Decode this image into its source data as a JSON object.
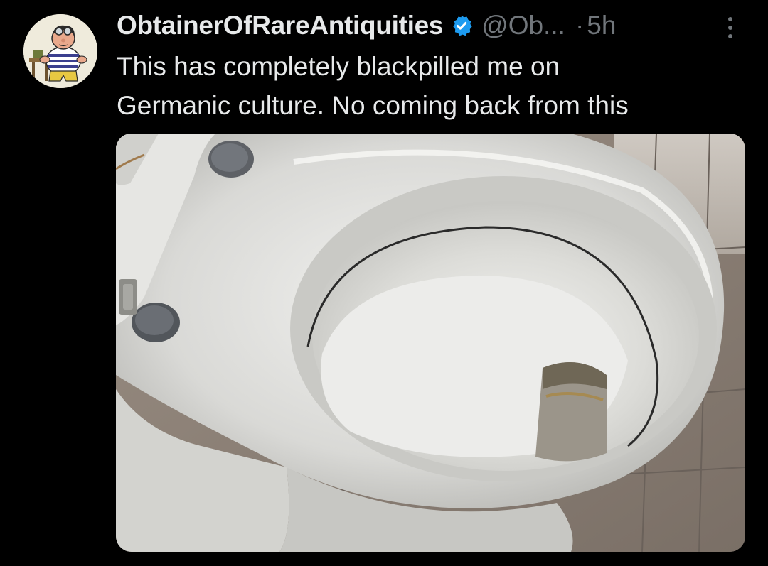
{
  "tweet": {
    "author": {
      "display_name": "ObtainerOfRareAntiquities",
      "handle": "@Ob...",
      "verified": true,
      "avatar_icon": "cartoon-character-avatar"
    },
    "separator": "·",
    "time": "5h",
    "text_lines": [
      "This has completely blackpilled me on",
      "Germanic culture. No coming back from this"
    ],
    "media": {
      "alt_icon": "toilet-photo"
    }
  },
  "colors": {
    "background": "#000000",
    "text_primary": "#e7e9ea",
    "text_secondary": "#71767b",
    "verified_badge": "#1d9bf0"
  }
}
